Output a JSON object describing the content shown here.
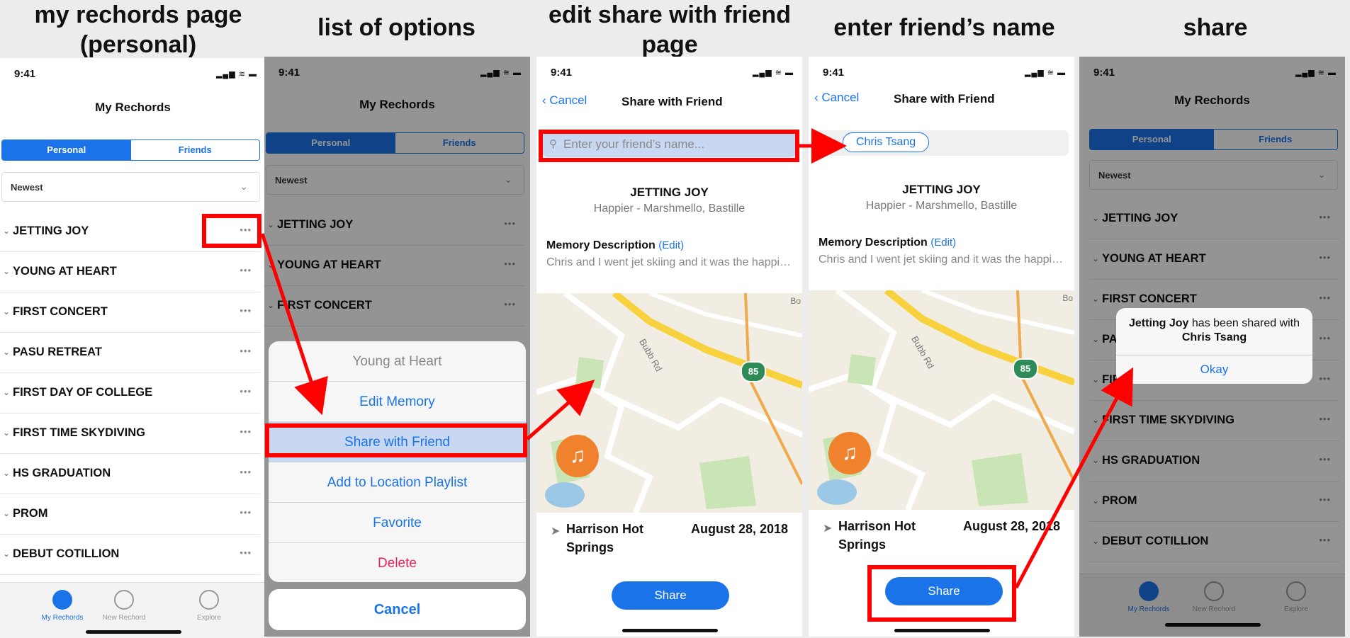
{
  "titles": [
    "my rechords page (personal)",
    "list of options",
    "edit share with friend page",
    "enter friend’s name",
    "share"
  ],
  "status": {
    "time": "9:41",
    "icons": "▂▄▆ ≋ ▬"
  },
  "list_screen": {
    "title": "My Rechords",
    "segments": [
      "Personal",
      "Friends"
    ],
    "sort": "Newest",
    "items": [
      "JETTING JOY",
      "YOUNG AT HEART",
      "FIRST CONCERT",
      "PASU RETREAT",
      "FIRST DAY OF COLLEGE",
      "FIRST TIME SKYDIVING",
      "HS GRADUATION",
      "PROM",
      "DEBUT COTILLION"
    ],
    "more": "•••",
    "chevron": "⌄",
    "tabs": [
      "My Rechords",
      "New Rechord",
      "Explore"
    ]
  },
  "options_sheet": {
    "header": "Young at Heart",
    "items": [
      "Edit Memory",
      "Share with Friend",
      "Add to Location Playlist",
      "Favorite",
      "Delete"
    ],
    "cancel": "Cancel",
    "delete_color": "#e0245e"
  },
  "share_screen": {
    "cancel": "Cancel",
    "title": "Share with Friend",
    "search_placeholder": "Enter your friend’s name...",
    "friend_chip": "Chris Tsang",
    "song_title": "JETTING JOY",
    "song_artist": "Happier - Marshmello, Bastille",
    "memory_heading": "Memory Description",
    "memory_edit": "(Edit)",
    "memory_text": "Chris and I went jet skiing and it was the happiest day of my life",
    "map_road": "Bubb Rd",
    "map_shield": "85",
    "map_corner": "Bo",
    "location": "Harrison Hot Springs",
    "date": "August 28, 2018",
    "share_label": "Share"
  },
  "alert": {
    "song": "Jetting Joy",
    "middle": "has been shared with",
    "friend": "Chris Tsang",
    "button": "Okay"
  },
  "colors": {
    "accent": "#1a73e8",
    "highlight": "#ff0000",
    "pin": "#f0822d"
  }
}
